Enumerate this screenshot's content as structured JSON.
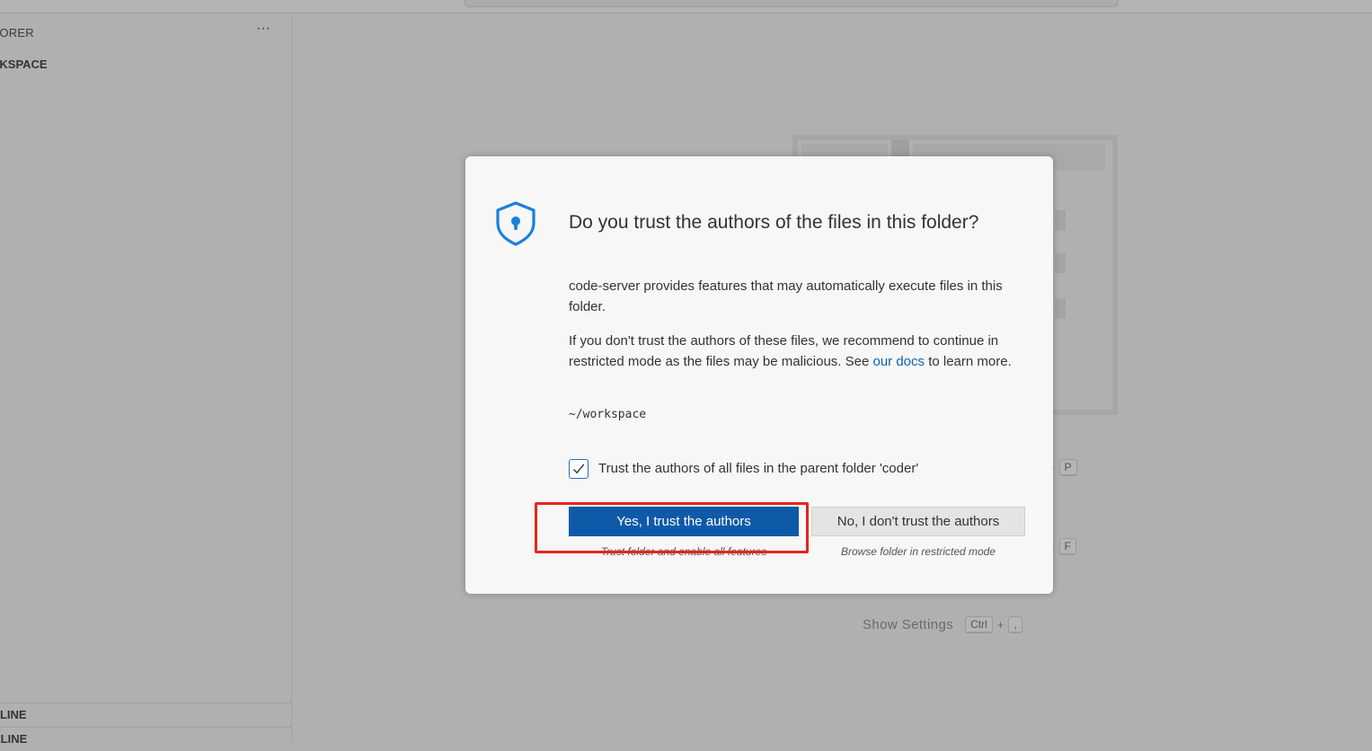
{
  "sidebar": {
    "explorer_title": "LORER",
    "more_actions": "···",
    "workspace_title": "RKSPACE",
    "outline_label": "TLINE",
    "timeline_label": "ELINE"
  },
  "editor": {
    "shortcuts": [
      {
        "label": "",
        "keys": [
          "",
          "P"
        ]
      },
      {
        "label": "",
        "keys": [
          "",
          "F"
        ]
      },
      {
        "label": "Show Settings",
        "keys": [
          "Ctrl",
          ","
        ]
      }
    ]
  },
  "dialog": {
    "icon": "shield-keyhole-icon",
    "title": "Do you trust the authors of the files in this folder?",
    "paragraph1": "code-server provides features that may automatically execute files in this folder.",
    "paragraph2_before": "If you don't trust the authors of these files, we recommend to continue in restricted mode as the files may be malicious. See ",
    "paragraph2_link": "our docs",
    "paragraph2_after": " to learn more.",
    "path": "~/workspace",
    "checkbox_label": "Trust the authors of all files in the parent folder 'coder'",
    "checkbox_checked": true,
    "yes_button": "Yes, I trust the authors",
    "yes_subtitle": "Trust folder and enable all features",
    "no_button": "No, I don't trust the authors",
    "no_subtitle": "Browse folder in restricted mode"
  },
  "colors": {
    "primary_button": "#0e5aa8",
    "link": "#1060b0",
    "highlight_box": "#e5241c"
  }
}
